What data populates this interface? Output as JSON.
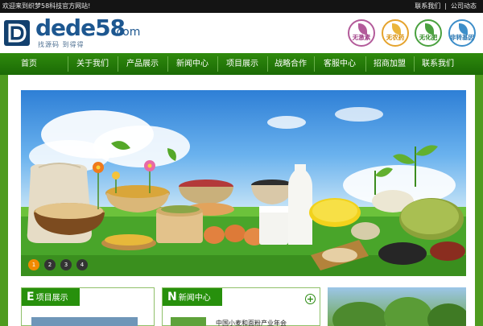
{
  "topbar": {
    "welcome": "欢迎来到织梦58科技官方网站!",
    "links": [
      "联系我们",
      "公司动态"
    ]
  },
  "header": {
    "logo_text": "dede58",
    "logo_suffix": ".com",
    "slogan": "找源码 到得得",
    "badges": [
      {
        "label": "无激素",
        "color": "#b35b9a"
      },
      {
        "label": "无农药",
        "color": "#e5a32d"
      },
      {
        "label": "无化肥",
        "color": "#4aa13f"
      },
      {
        "label": "非转基因",
        "color": "#3d8ec9"
      }
    ]
  },
  "nav": {
    "items": [
      "首页",
      "关于我们",
      "产品展示",
      "新闻中心",
      "项目展示",
      "战略合作",
      "客服中心",
      "招商加盟",
      "联系我们"
    ]
  },
  "banner": {
    "slides": [
      "1",
      "2",
      "3",
      "4"
    ],
    "active_slide": 1
  },
  "panels": {
    "projects": {
      "initial": "E",
      "title": "项目展示"
    },
    "news": {
      "initial": "N",
      "title": "新闻中心",
      "more_icon": "plus-icon",
      "first_item": "中国小麦和面粉产业年会"
    }
  },
  "colors": {
    "nav_green": "#1e7a07",
    "accent_orange": "#f08a00",
    "brand_blue": "#1d5790"
  }
}
